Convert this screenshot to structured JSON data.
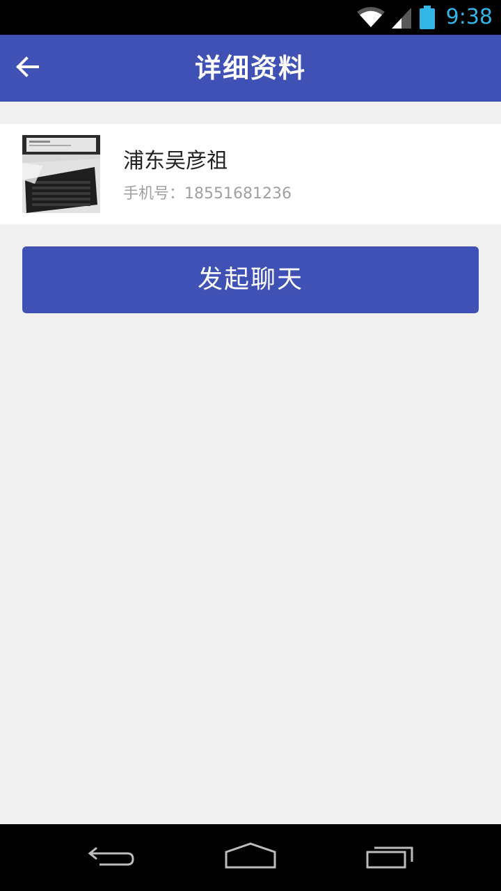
{
  "status_bar": {
    "time": "9:38",
    "icons": [
      "wifi-icon",
      "signal-icon",
      "battery-icon"
    ],
    "time_color": "#33b5e5"
  },
  "app_bar": {
    "title": "详细资料",
    "back_icon": "arrow-left-icon",
    "color": "#3f51b5"
  },
  "contact": {
    "name": "浦东吴彦祖",
    "phone_label": "手机号：",
    "phone_value": "18551681236",
    "avatar": "keyboard-photo"
  },
  "actions": {
    "start_chat_label": "发起聊天"
  },
  "nav_bar": {
    "icons": [
      "back-nav-icon",
      "home-nav-icon",
      "recents-nav-icon"
    ]
  }
}
